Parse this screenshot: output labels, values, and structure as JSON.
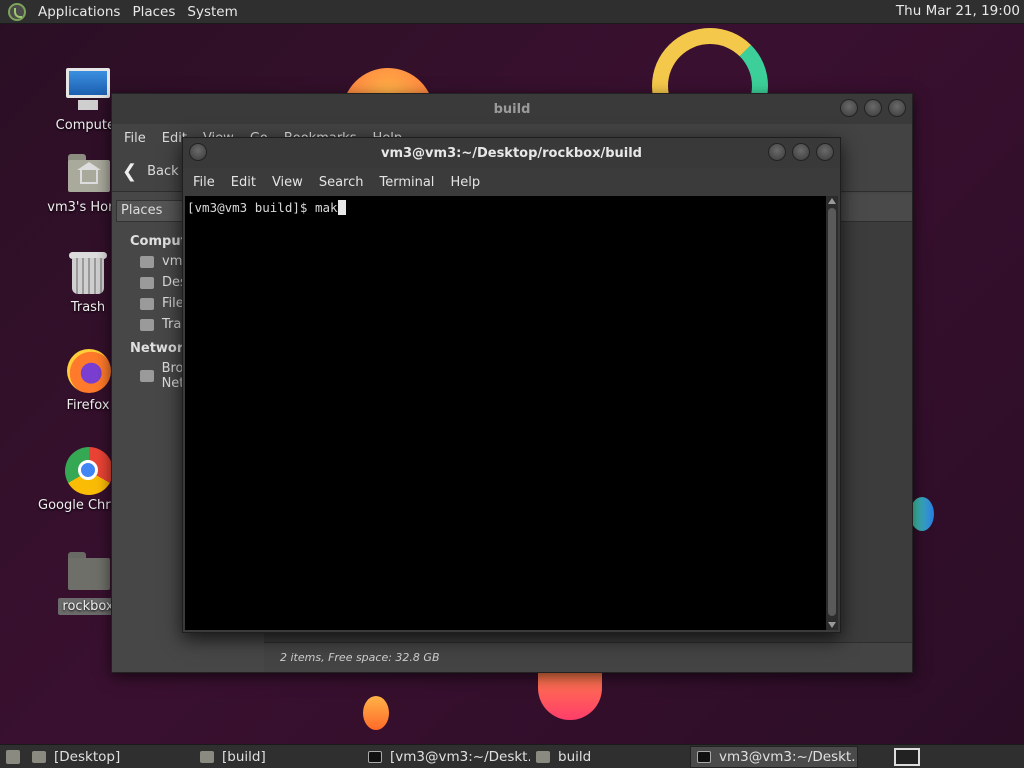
{
  "top_panel": {
    "menus": [
      "Applications",
      "Places",
      "System"
    ],
    "clock": "Thu Mar 21, 19:00"
  },
  "desktop_icons": [
    {
      "label": "Computer",
      "icon": "computer-icon"
    },
    {
      "label": "vm3's Home",
      "icon": "home-folder-icon"
    },
    {
      "label": "Trash",
      "icon": "trash-icon"
    },
    {
      "label": "Firefox",
      "icon": "firefox-icon"
    },
    {
      "label": "Google Chrome",
      "icon": "chrome-icon"
    },
    {
      "label": "rockbox",
      "icon": "folder-icon"
    }
  ],
  "file_manager": {
    "title": "build",
    "menus": [
      "File",
      "Edit",
      "View",
      "Go",
      "Bookmarks",
      "Help"
    ],
    "back_label": "Back",
    "places_label": "Places",
    "sidebar": {
      "computer_heading": "Computer",
      "computer_items": [
        "vm3",
        "Desktop",
        "File System",
        "Trash"
      ],
      "network_heading": "Network",
      "network_items": [
        "Browse Network"
      ]
    },
    "status": "2 items, Free space: 32.8 GB"
  },
  "terminal": {
    "title": "vm3@vm3:~/Desktop/rockbox/build",
    "menus": [
      "File",
      "Edit",
      "View",
      "Search",
      "Terminal",
      "Help"
    ],
    "prompt": "[vm3@vm3 build]$ ",
    "typed": "mak"
  },
  "taskbar": {
    "tasks": [
      {
        "label": "[Desktop]",
        "icon": "folder-icon",
        "active": false
      },
      {
        "label": "[build]",
        "icon": "folder-icon",
        "active": false
      },
      {
        "label": "[vm3@vm3:~/Deskt...",
        "icon": "terminal-icon",
        "active": false
      },
      {
        "label": "build",
        "icon": "folder-icon",
        "active": false
      },
      {
        "label": "vm3@vm3:~/Deskt...",
        "icon": "terminal-icon",
        "active": true
      }
    ]
  }
}
